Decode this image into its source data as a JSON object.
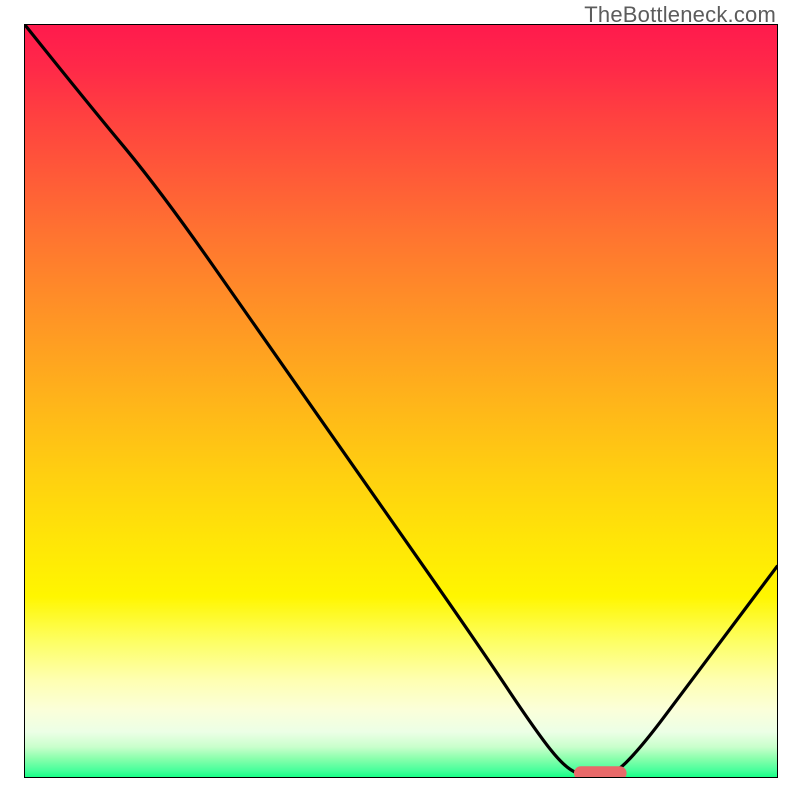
{
  "attribution": "TheBottleneck.com",
  "chart_data": {
    "type": "line",
    "title": "",
    "xlabel": "",
    "ylabel": "",
    "xlim": [
      0,
      100
    ],
    "ylim": [
      0,
      100
    ],
    "grid": false,
    "series": [
      {
        "name": "bottleneck-curve",
        "x": [
          0,
          8,
          18,
          32,
          46,
          60,
          68,
          72,
          75,
          78,
          82,
          88,
          94,
          100
        ],
        "values": [
          100,
          90,
          78,
          58,
          38,
          18,
          6,
          1,
          0,
          0,
          4,
          12,
          20,
          28
        ]
      }
    ],
    "marker": {
      "name": "optimal-range",
      "x_start": 73,
      "x_end": 80,
      "y": 0.5,
      "color": "#e86a6a"
    },
    "background": "rainbow-gradient-vertical",
    "colors": {
      "curve": "#000000",
      "marker": "#e86a6a"
    }
  }
}
